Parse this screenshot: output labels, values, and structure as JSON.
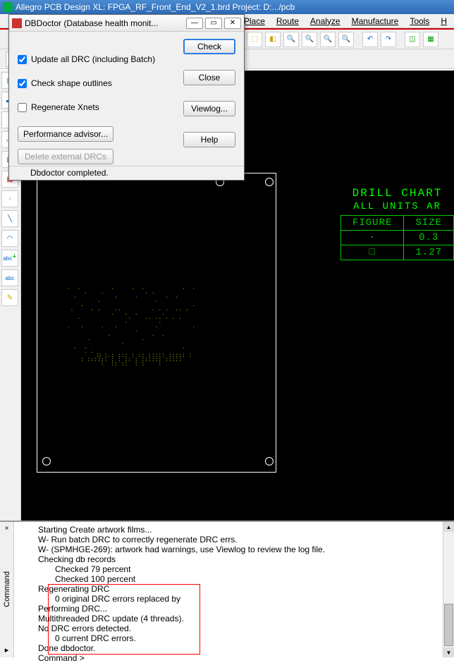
{
  "titlebar": "Allegro PCB Design XL: FPGA_RF_Front_End_V2_1.brd   Project: D:.../pcb",
  "menus": {
    "place": "Place",
    "route": "Route",
    "analyze": "Analyze",
    "manufacture": "Manufacture",
    "tools": "Tools",
    "help": "H"
  },
  "dialog": {
    "title": "DBDoctor (Database health monit...",
    "update_drc": "Update all DRC (including Batch)",
    "check_shape": "Check shape outlines",
    "regen_xnets": "Regenerate Xnets",
    "perf_advisor": "Performance advisor...",
    "delete_ext": "Delete external DRCs",
    "check_btn": "Check",
    "close_btn": "Close",
    "viewlog_btn": "Viewlog...",
    "help_btn": "Help",
    "status": "Dbdoctor completed."
  },
  "drill": {
    "title": "DRILL CHART",
    "sub": "ALL UNITS AR",
    "h1": "FIGURE",
    "h2": "SIZE",
    "r1c1": "·",
    "r1c2": "0.3",
    "r2c1": "□",
    "r2c2": "1.27"
  },
  "cmd": {
    "l1": "Starting Create artwork films...",
    "l2": "W- Run batch DRC to correctly regenerate DRC errs.",
    "l3": "W- (SPMHGE-269): artwork had warnings, use Viewlog to review the log file.",
    "l4": "Checking db records",
    "l5": "Checked  79 percent",
    "l6": "Checked 100 percent",
    "l7": "Regenerating DRC",
    "l8": "0 original DRC errors replaced by",
    "l9": "Performing DRC...",
    "l10": "Multithreaded DRC update (4 threads).",
    "l11": "No DRC errors detected.",
    "l12": "0 current DRC errors.",
    "l13": "Done dbdoctor.",
    "l14": "Command >"
  },
  "cmdlabel": "Command"
}
